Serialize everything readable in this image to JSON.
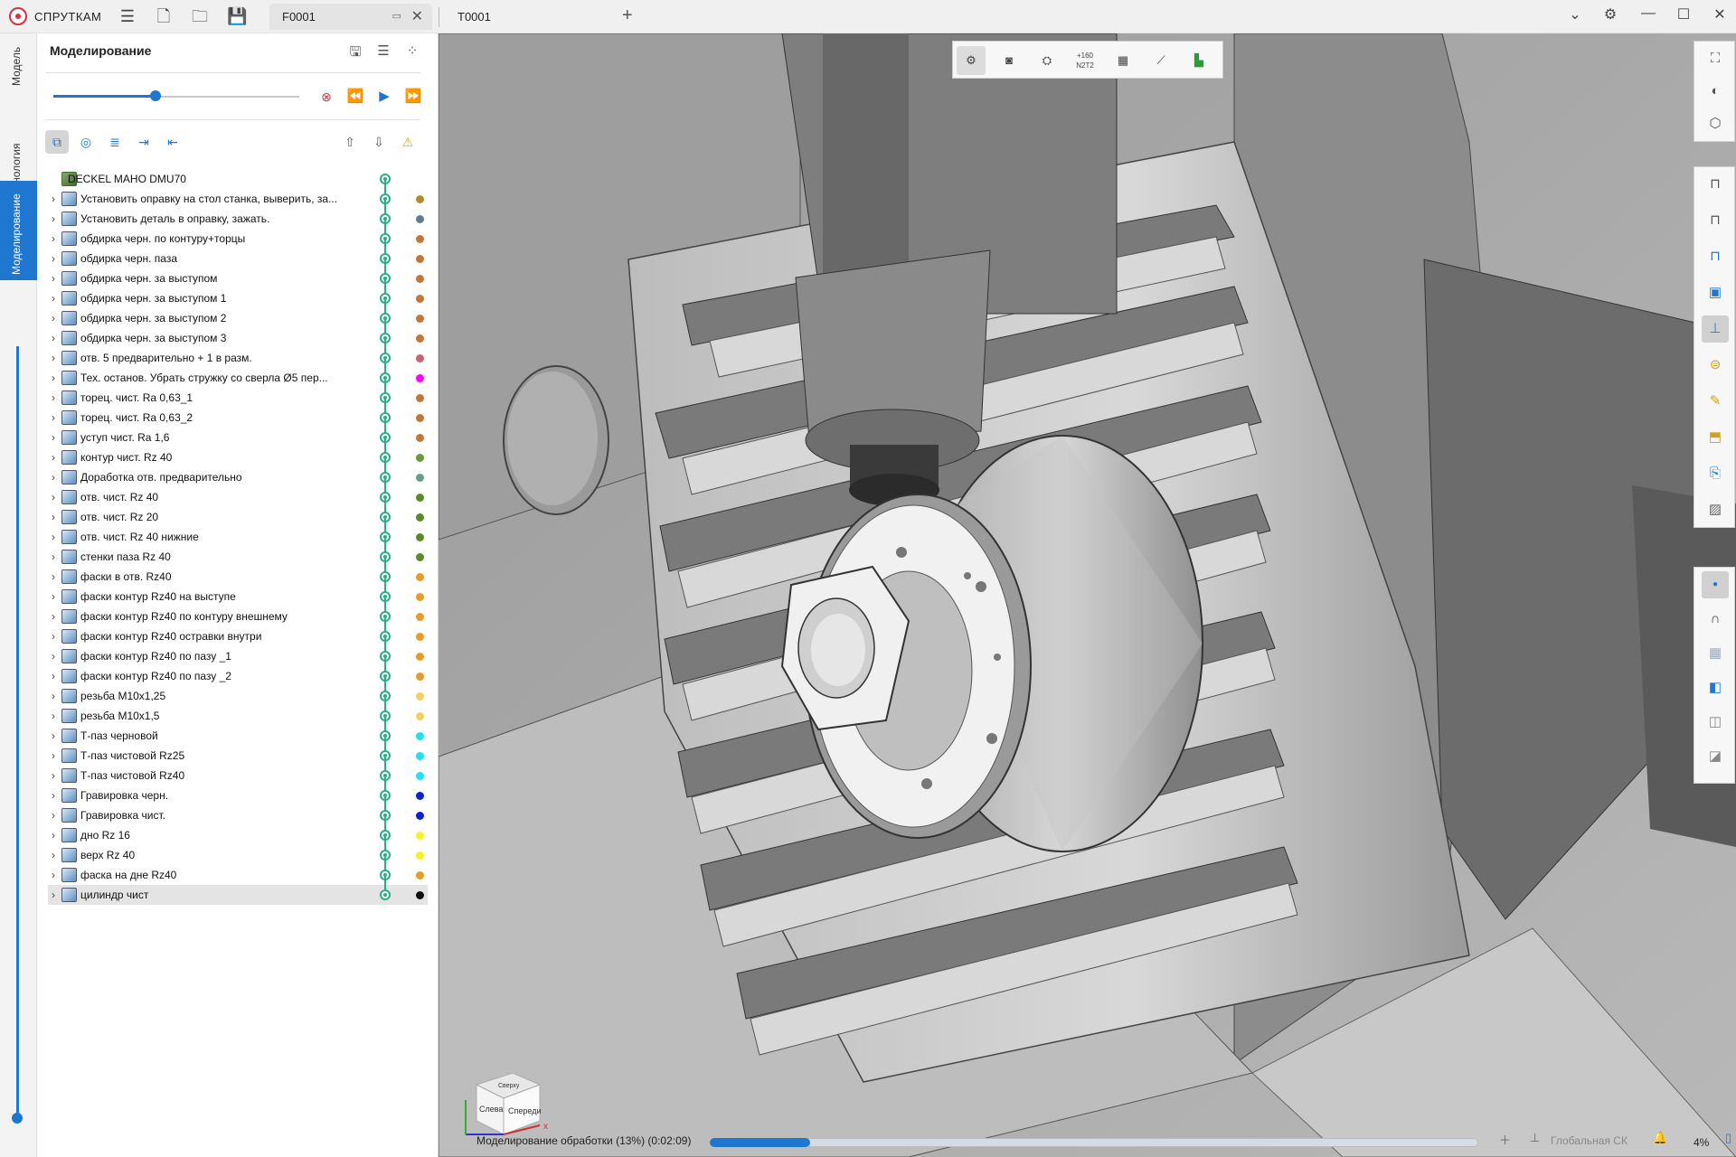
{
  "app": {
    "name": "СПРУТКАМ"
  },
  "tabs": [
    {
      "label": "F0001",
      "active": true
    },
    {
      "label": "T0001",
      "active": false
    }
  ],
  "side_tabs": [
    "Модель",
    "Технология",
    "Моделирование"
  ],
  "panel": {
    "title": "Моделирование",
    "progress_fraction": 0.5
  },
  "tree": {
    "root": "DECKEL MAHO DMU70",
    "items": [
      {
        "label": "Установить оправку на стол станка, выверить, за...",
        "color": "#b8872d"
      },
      {
        "label": "Установить деталь в оправку, зажать.",
        "color": "#607d8b"
      },
      {
        "label": "обдирка черн. по контуру+торцы",
        "color": "#c0773a"
      },
      {
        "label": "обдирка черн. паза",
        "color": "#c0773a"
      },
      {
        "label": "обдирка черн. за выступом",
        "color": "#c0773a"
      },
      {
        "label": "обдирка черн. за выступом 1",
        "color": "#c0773a"
      },
      {
        "label": "обдирка черн. за выступом 2",
        "color": "#c0773a"
      },
      {
        "label": "обдирка черн. за выступом 3",
        "color": "#c0773a"
      },
      {
        "label": "отв. 5 предварительно + 1 в разм.",
        "color": "#c76377"
      },
      {
        "label": "Тех. останов. Убрать стружку со сверла Ø5 пер...",
        "color": "#ff00ff"
      },
      {
        "label": "торец. чист. Ra 0,63_1",
        "color": "#c0773a"
      },
      {
        "label": "торец. чист. Ra 0,63_2",
        "color": "#c0773a"
      },
      {
        "label": "уступ чист. Ra 1,6",
        "color": "#c0773a"
      },
      {
        "label": "контур чист. Rz 40",
        "color": "#6c9a3a"
      },
      {
        "label": "Доработка отв. предварительно",
        "color": "#6a9a8a"
      },
      {
        "label": "отв. чист. Rz 40",
        "color": "#5a8a2a"
      },
      {
        "label": "отв. чист. Rz 20",
        "color": "#5a8a2a"
      },
      {
        "label": "отв. чист. Rz 40 нижние",
        "color": "#5a8a2a"
      },
      {
        "label": "стенки паза Rz 40",
        "color": "#5a8a2a"
      },
      {
        "label": "фаски в отв. Rz40",
        "color": "#e89a2a"
      },
      {
        "label": "фаски контур Rz40  на выступе",
        "color": "#e89a2a"
      },
      {
        "label": "фаски контур Rz40 по контуру внешнему",
        "color": "#e89a2a"
      },
      {
        "label": "фаски контур Rz40 остравки внутри",
        "color": "#e89a2a"
      },
      {
        "label": "фаски контур Rz40 по пазу _1",
        "color": "#e89a2a"
      },
      {
        "label": "фаски контур Rz40 по пазу _2",
        "color": "#e89a2a"
      },
      {
        "label": "резьба М10х1,25",
        "color": "#f0d060"
      },
      {
        "label": "резьба М10х1,5",
        "color": "#f0d060"
      },
      {
        "label": "Т-паз черновой",
        "color": "#22e0f0"
      },
      {
        "label": "Т-паз чистовой Rz25",
        "color": "#22e0f0"
      },
      {
        "label": "Т-паз чистовой Rz40",
        "color": "#22e0f0"
      },
      {
        "label": "Гравировка черн.",
        "color": "#1020d0"
      },
      {
        "label": "Гравировка чист.",
        "color": "#1020d0"
      },
      {
        "label": "дно  Rz 16",
        "color": "#f8f020"
      },
      {
        "label": "верх  Rz 40",
        "color": "#f8f020"
      },
      {
        "label": "фаска на дне Rz40",
        "color": "#e89a2a"
      },
      {
        "label": "цилиндр чист",
        "color": "#111111",
        "selected": true
      }
    ]
  },
  "viewport_toolbar": {
    "counter_label": "+160\nN2T2"
  },
  "viewcube": {
    "left": "Слева",
    "front": "Спереди",
    "top": "Сверху",
    "axis_x": "x"
  },
  "status": {
    "text": "Моделирование обработки (13%) (0:02:09)",
    "progress": 0.13,
    "cs_label": "Глобальная СК",
    "zoom": "4%"
  }
}
